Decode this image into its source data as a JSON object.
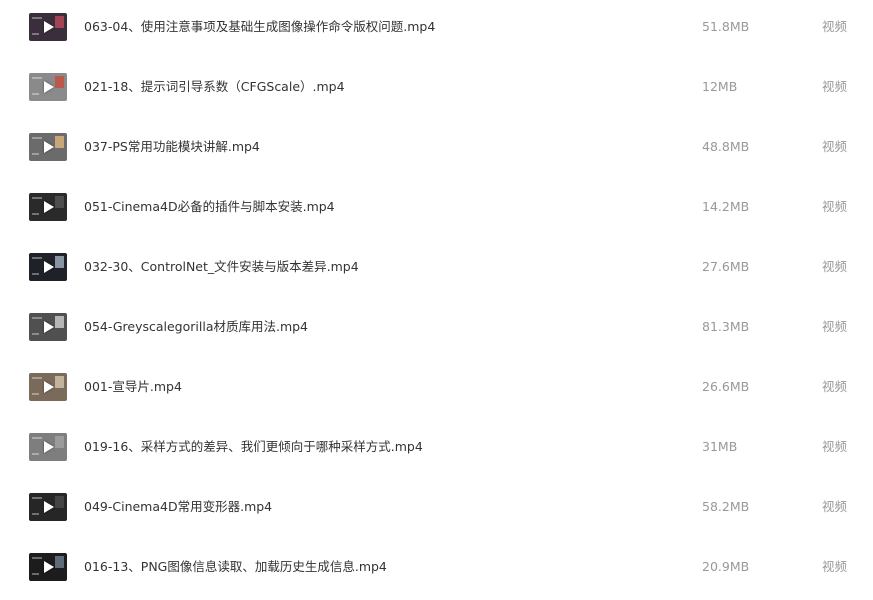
{
  "files": [
    {
      "name": "063-04、使用注意事项及基础生成图像操作命令版权问题.mp4",
      "size": "51.8MB",
      "type": "视频",
      "thumb_color": "#3a2e3c",
      "accent": "#b5485a"
    },
    {
      "name": "021-18、提示词引导系数（CFGScale）.mp4",
      "size": "12MB",
      "type": "视频",
      "thumb_color": "#8a8a8a",
      "accent": "#c05040"
    },
    {
      "name": "037-PS常用功能模块讲解.mp4",
      "size": "48.8MB",
      "type": "视频",
      "thumb_color": "#6b6b6b",
      "accent": "#d8b07a"
    },
    {
      "name": "051-Cinema4D必备的插件与脚本安装.mp4",
      "size": "14.2MB",
      "type": "视频",
      "thumb_color": "#2a2a2a",
      "accent": "#555555"
    },
    {
      "name": "032-30、ControlNet_文件安装与版本差异.mp4",
      "size": "27.6MB",
      "type": "视频",
      "thumb_color": "#1e2228",
      "accent": "#9aa8b8"
    },
    {
      "name": "054-Greyscalegorilla材质库用法.mp4",
      "size": "81.3MB",
      "type": "视频",
      "thumb_color": "#505050",
      "accent": "#c8c8c8"
    },
    {
      "name": "001-宣导片.mp4",
      "size": "26.6MB",
      "type": "视频",
      "thumb_color": "#7a6a5a",
      "accent": "#d0c0a8"
    },
    {
      "name": "019-16、采样方式的差异、我们更倾向于哪种采样方式.mp4",
      "size": "31MB",
      "type": "视频",
      "thumb_color": "#7e7e7e",
      "accent": "#a0a0a0"
    },
    {
      "name": "049-Cinema4D常用变形器.mp4",
      "size": "58.2MB",
      "type": "视频",
      "thumb_color": "#262626",
      "accent": "#4a4a4a"
    },
    {
      "name": "016-13、PNG图像信息读取、加载历史生成信息.mp4",
      "size": "20.9MB",
      "type": "视频",
      "thumb_color": "#1c1c1c",
      "accent": "#6a7a8a"
    }
  ]
}
